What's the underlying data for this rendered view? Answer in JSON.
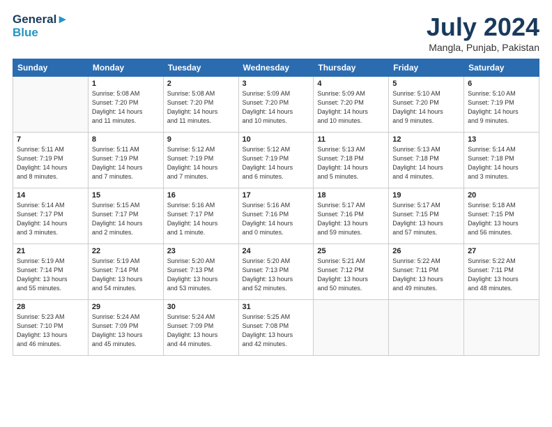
{
  "header": {
    "logo_line1": "General",
    "logo_line2": "Blue",
    "month": "July 2024",
    "location": "Mangla, Punjab, Pakistan"
  },
  "days_of_week": [
    "Sunday",
    "Monday",
    "Tuesday",
    "Wednesday",
    "Thursday",
    "Friday",
    "Saturday"
  ],
  "weeks": [
    [
      {
        "day": "",
        "info": ""
      },
      {
        "day": "1",
        "info": "Sunrise: 5:08 AM\nSunset: 7:20 PM\nDaylight: 14 hours\nand 11 minutes."
      },
      {
        "day": "2",
        "info": "Sunrise: 5:08 AM\nSunset: 7:20 PM\nDaylight: 14 hours\nand 11 minutes."
      },
      {
        "day": "3",
        "info": "Sunrise: 5:09 AM\nSunset: 7:20 PM\nDaylight: 14 hours\nand 10 minutes."
      },
      {
        "day": "4",
        "info": "Sunrise: 5:09 AM\nSunset: 7:20 PM\nDaylight: 14 hours\nand 10 minutes."
      },
      {
        "day": "5",
        "info": "Sunrise: 5:10 AM\nSunset: 7:20 PM\nDaylight: 14 hours\nand 9 minutes."
      },
      {
        "day": "6",
        "info": "Sunrise: 5:10 AM\nSunset: 7:19 PM\nDaylight: 14 hours\nand 9 minutes."
      }
    ],
    [
      {
        "day": "7",
        "info": "Sunrise: 5:11 AM\nSunset: 7:19 PM\nDaylight: 14 hours\nand 8 minutes."
      },
      {
        "day": "8",
        "info": "Sunrise: 5:11 AM\nSunset: 7:19 PM\nDaylight: 14 hours\nand 7 minutes."
      },
      {
        "day": "9",
        "info": "Sunrise: 5:12 AM\nSunset: 7:19 PM\nDaylight: 14 hours\nand 7 minutes."
      },
      {
        "day": "10",
        "info": "Sunrise: 5:12 AM\nSunset: 7:19 PM\nDaylight: 14 hours\nand 6 minutes."
      },
      {
        "day": "11",
        "info": "Sunrise: 5:13 AM\nSunset: 7:18 PM\nDaylight: 14 hours\nand 5 minutes."
      },
      {
        "day": "12",
        "info": "Sunrise: 5:13 AM\nSunset: 7:18 PM\nDaylight: 14 hours\nand 4 minutes."
      },
      {
        "day": "13",
        "info": "Sunrise: 5:14 AM\nSunset: 7:18 PM\nDaylight: 14 hours\nand 3 minutes."
      }
    ],
    [
      {
        "day": "14",
        "info": "Sunrise: 5:14 AM\nSunset: 7:17 PM\nDaylight: 14 hours\nand 3 minutes."
      },
      {
        "day": "15",
        "info": "Sunrise: 5:15 AM\nSunset: 7:17 PM\nDaylight: 14 hours\nand 2 minutes."
      },
      {
        "day": "16",
        "info": "Sunrise: 5:16 AM\nSunset: 7:17 PM\nDaylight: 14 hours\nand 1 minute."
      },
      {
        "day": "17",
        "info": "Sunrise: 5:16 AM\nSunset: 7:16 PM\nDaylight: 14 hours\nand 0 minutes."
      },
      {
        "day": "18",
        "info": "Sunrise: 5:17 AM\nSunset: 7:16 PM\nDaylight: 13 hours\nand 59 minutes."
      },
      {
        "day": "19",
        "info": "Sunrise: 5:17 AM\nSunset: 7:15 PM\nDaylight: 13 hours\nand 57 minutes."
      },
      {
        "day": "20",
        "info": "Sunrise: 5:18 AM\nSunset: 7:15 PM\nDaylight: 13 hours\nand 56 minutes."
      }
    ],
    [
      {
        "day": "21",
        "info": "Sunrise: 5:19 AM\nSunset: 7:14 PM\nDaylight: 13 hours\nand 55 minutes."
      },
      {
        "day": "22",
        "info": "Sunrise: 5:19 AM\nSunset: 7:14 PM\nDaylight: 13 hours\nand 54 minutes."
      },
      {
        "day": "23",
        "info": "Sunrise: 5:20 AM\nSunset: 7:13 PM\nDaylight: 13 hours\nand 53 minutes."
      },
      {
        "day": "24",
        "info": "Sunrise: 5:20 AM\nSunset: 7:13 PM\nDaylight: 13 hours\nand 52 minutes."
      },
      {
        "day": "25",
        "info": "Sunrise: 5:21 AM\nSunset: 7:12 PM\nDaylight: 13 hours\nand 50 minutes."
      },
      {
        "day": "26",
        "info": "Sunrise: 5:22 AM\nSunset: 7:11 PM\nDaylight: 13 hours\nand 49 minutes."
      },
      {
        "day": "27",
        "info": "Sunrise: 5:22 AM\nSunset: 7:11 PM\nDaylight: 13 hours\nand 48 minutes."
      }
    ],
    [
      {
        "day": "28",
        "info": "Sunrise: 5:23 AM\nSunset: 7:10 PM\nDaylight: 13 hours\nand 46 minutes."
      },
      {
        "day": "29",
        "info": "Sunrise: 5:24 AM\nSunset: 7:09 PM\nDaylight: 13 hours\nand 45 minutes."
      },
      {
        "day": "30",
        "info": "Sunrise: 5:24 AM\nSunset: 7:09 PM\nDaylight: 13 hours\nand 44 minutes."
      },
      {
        "day": "31",
        "info": "Sunrise: 5:25 AM\nSunset: 7:08 PM\nDaylight: 13 hours\nand 42 minutes."
      },
      {
        "day": "",
        "info": ""
      },
      {
        "day": "",
        "info": ""
      },
      {
        "day": "",
        "info": ""
      }
    ]
  ]
}
